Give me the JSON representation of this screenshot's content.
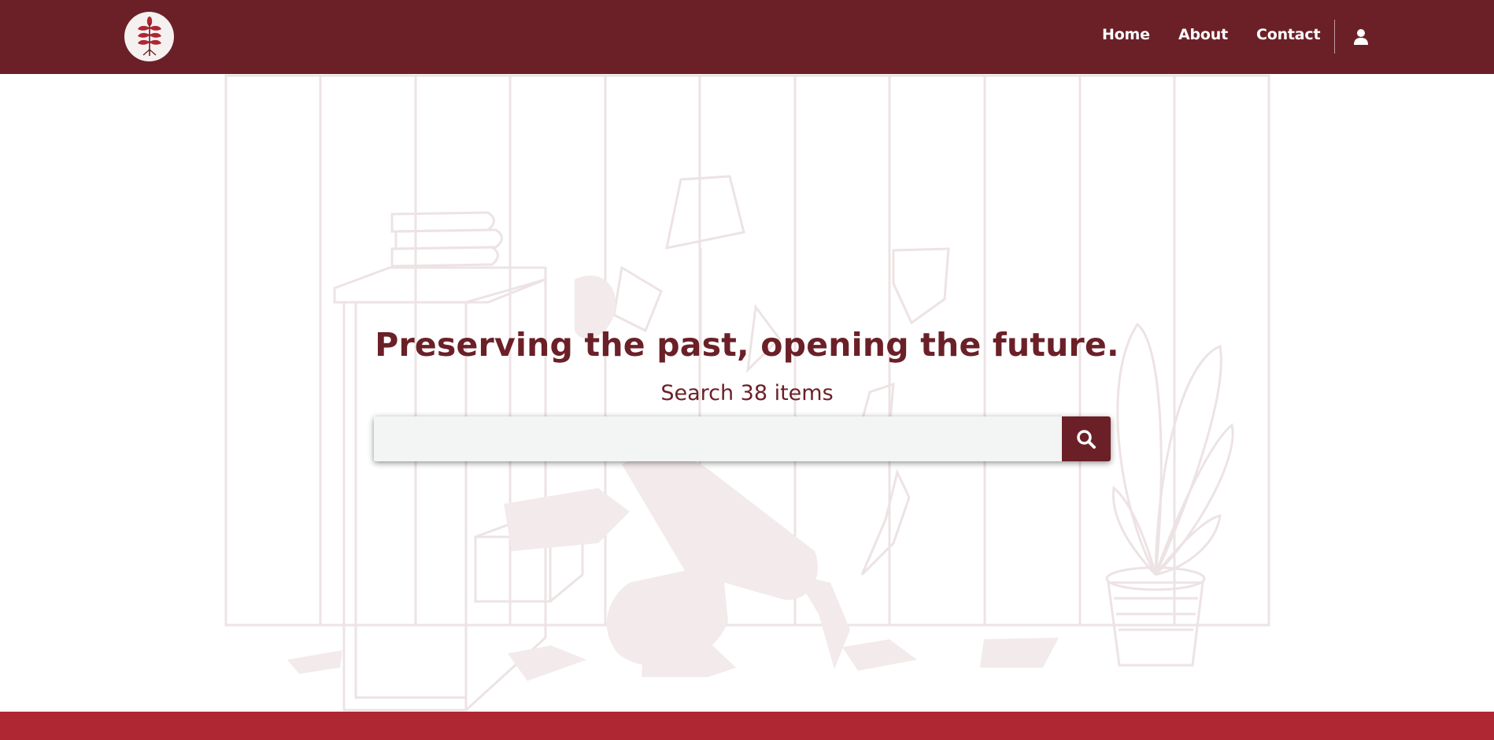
{
  "header": {
    "logo_icon": "leaf-sprig-icon",
    "nav": [
      {
        "label": "Home"
      },
      {
        "label": "About"
      },
      {
        "label": "Contact"
      }
    ],
    "user_icon": "user-icon"
  },
  "hero": {
    "title": "Preserving the past, opening the future.",
    "subtitle": "Search 38 items",
    "search": {
      "value": "",
      "placeholder": "",
      "button_icon": "search-icon"
    },
    "background_illustration": "person-searching-files-illustration"
  },
  "colors": {
    "brand": "#6b2027",
    "footer": "#ae2732",
    "input_bg": "#f3f4f4",
    "illustration_line": "#ede3e4",
    "illustration_fill": "#f2eaeb"
  }
}
